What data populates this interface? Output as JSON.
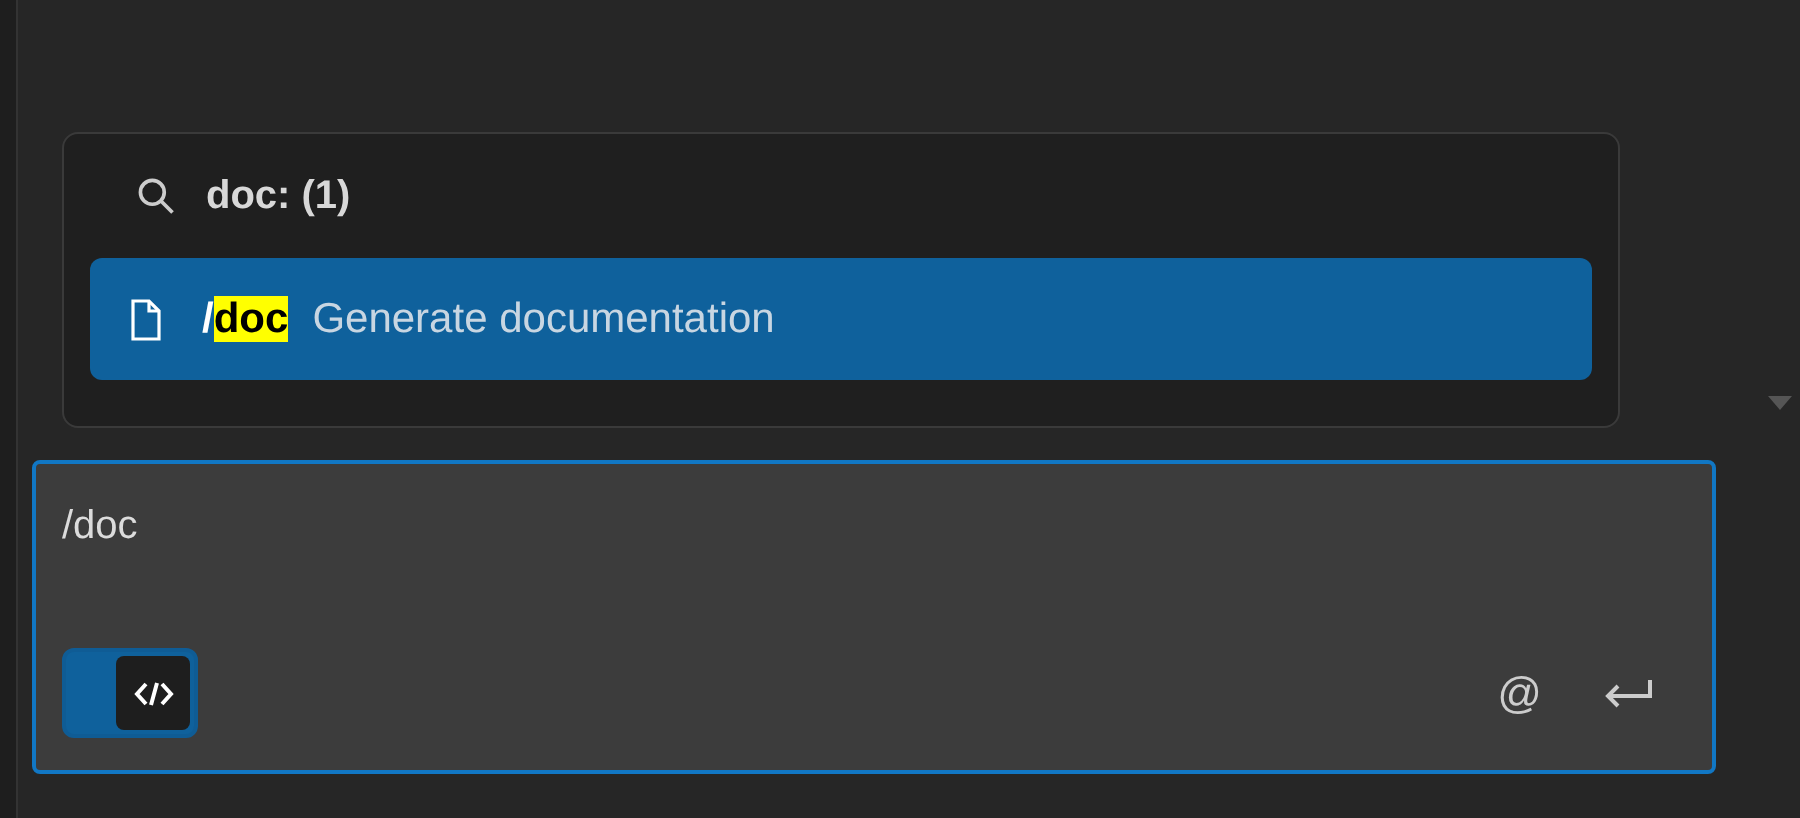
{
  "suggestions": {
    "query": "doc: (1)",
    "items": [
      {
        "command": "/**doc**",
        "description": "Generate documentation",
        "selected": true
      }
    ]
  },
  "input": {
    "value": "/doc",
    "mode_toggle": {
      "on": true
    },
    "mention_label": "@"
  }
}
